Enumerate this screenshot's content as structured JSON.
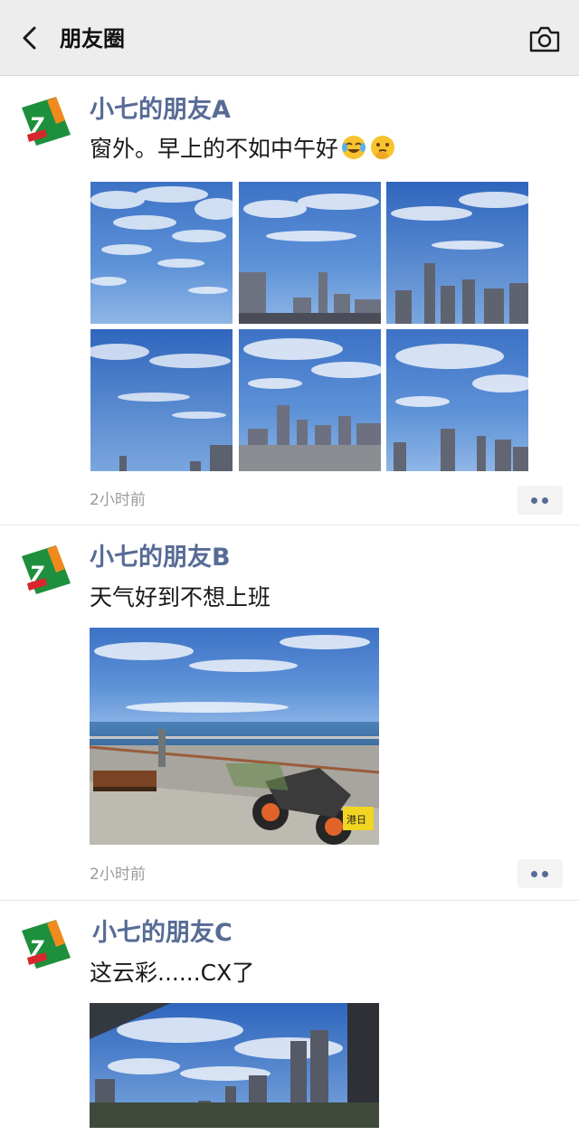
{
  "header": {
    "title": "朋友圈",
    "back_icon": "chevron-left-icon",
    "camera_icon": "camera-icon",
    "bg_color": "#ededed"
  },
  "accent_color": "#576b95",
  "posts": [
    {
      "author": "小七的朋友A",
      "text": "窗外。早上的不如中午好",
      "emojis": [
        "laughing-tears-emoji",
        "thinking-hand-emoji"
      ],
      "images": [
        "sky-clouds",
        "sky-city",
        "sky-city-towers",
        "sky-clouds-tower",
        "sky-city-dense",
        "sky-city-wide"
      ],
      "time": "2小时前"
    },
    {
      "author": "小七的朋友B",
      "text": "天气好到不想上班",
      "images": [
        "seaside-motorcycle-bench"
      ],
      "plate_text": "港日",
      "time": "2小时前"
    },
    {
      "author": "小七的朋友C",
      "text": "这云彩......CX了",
      "images": [
        "cloudy-sky-city-skyline"
      ]
    }
  ]
}
